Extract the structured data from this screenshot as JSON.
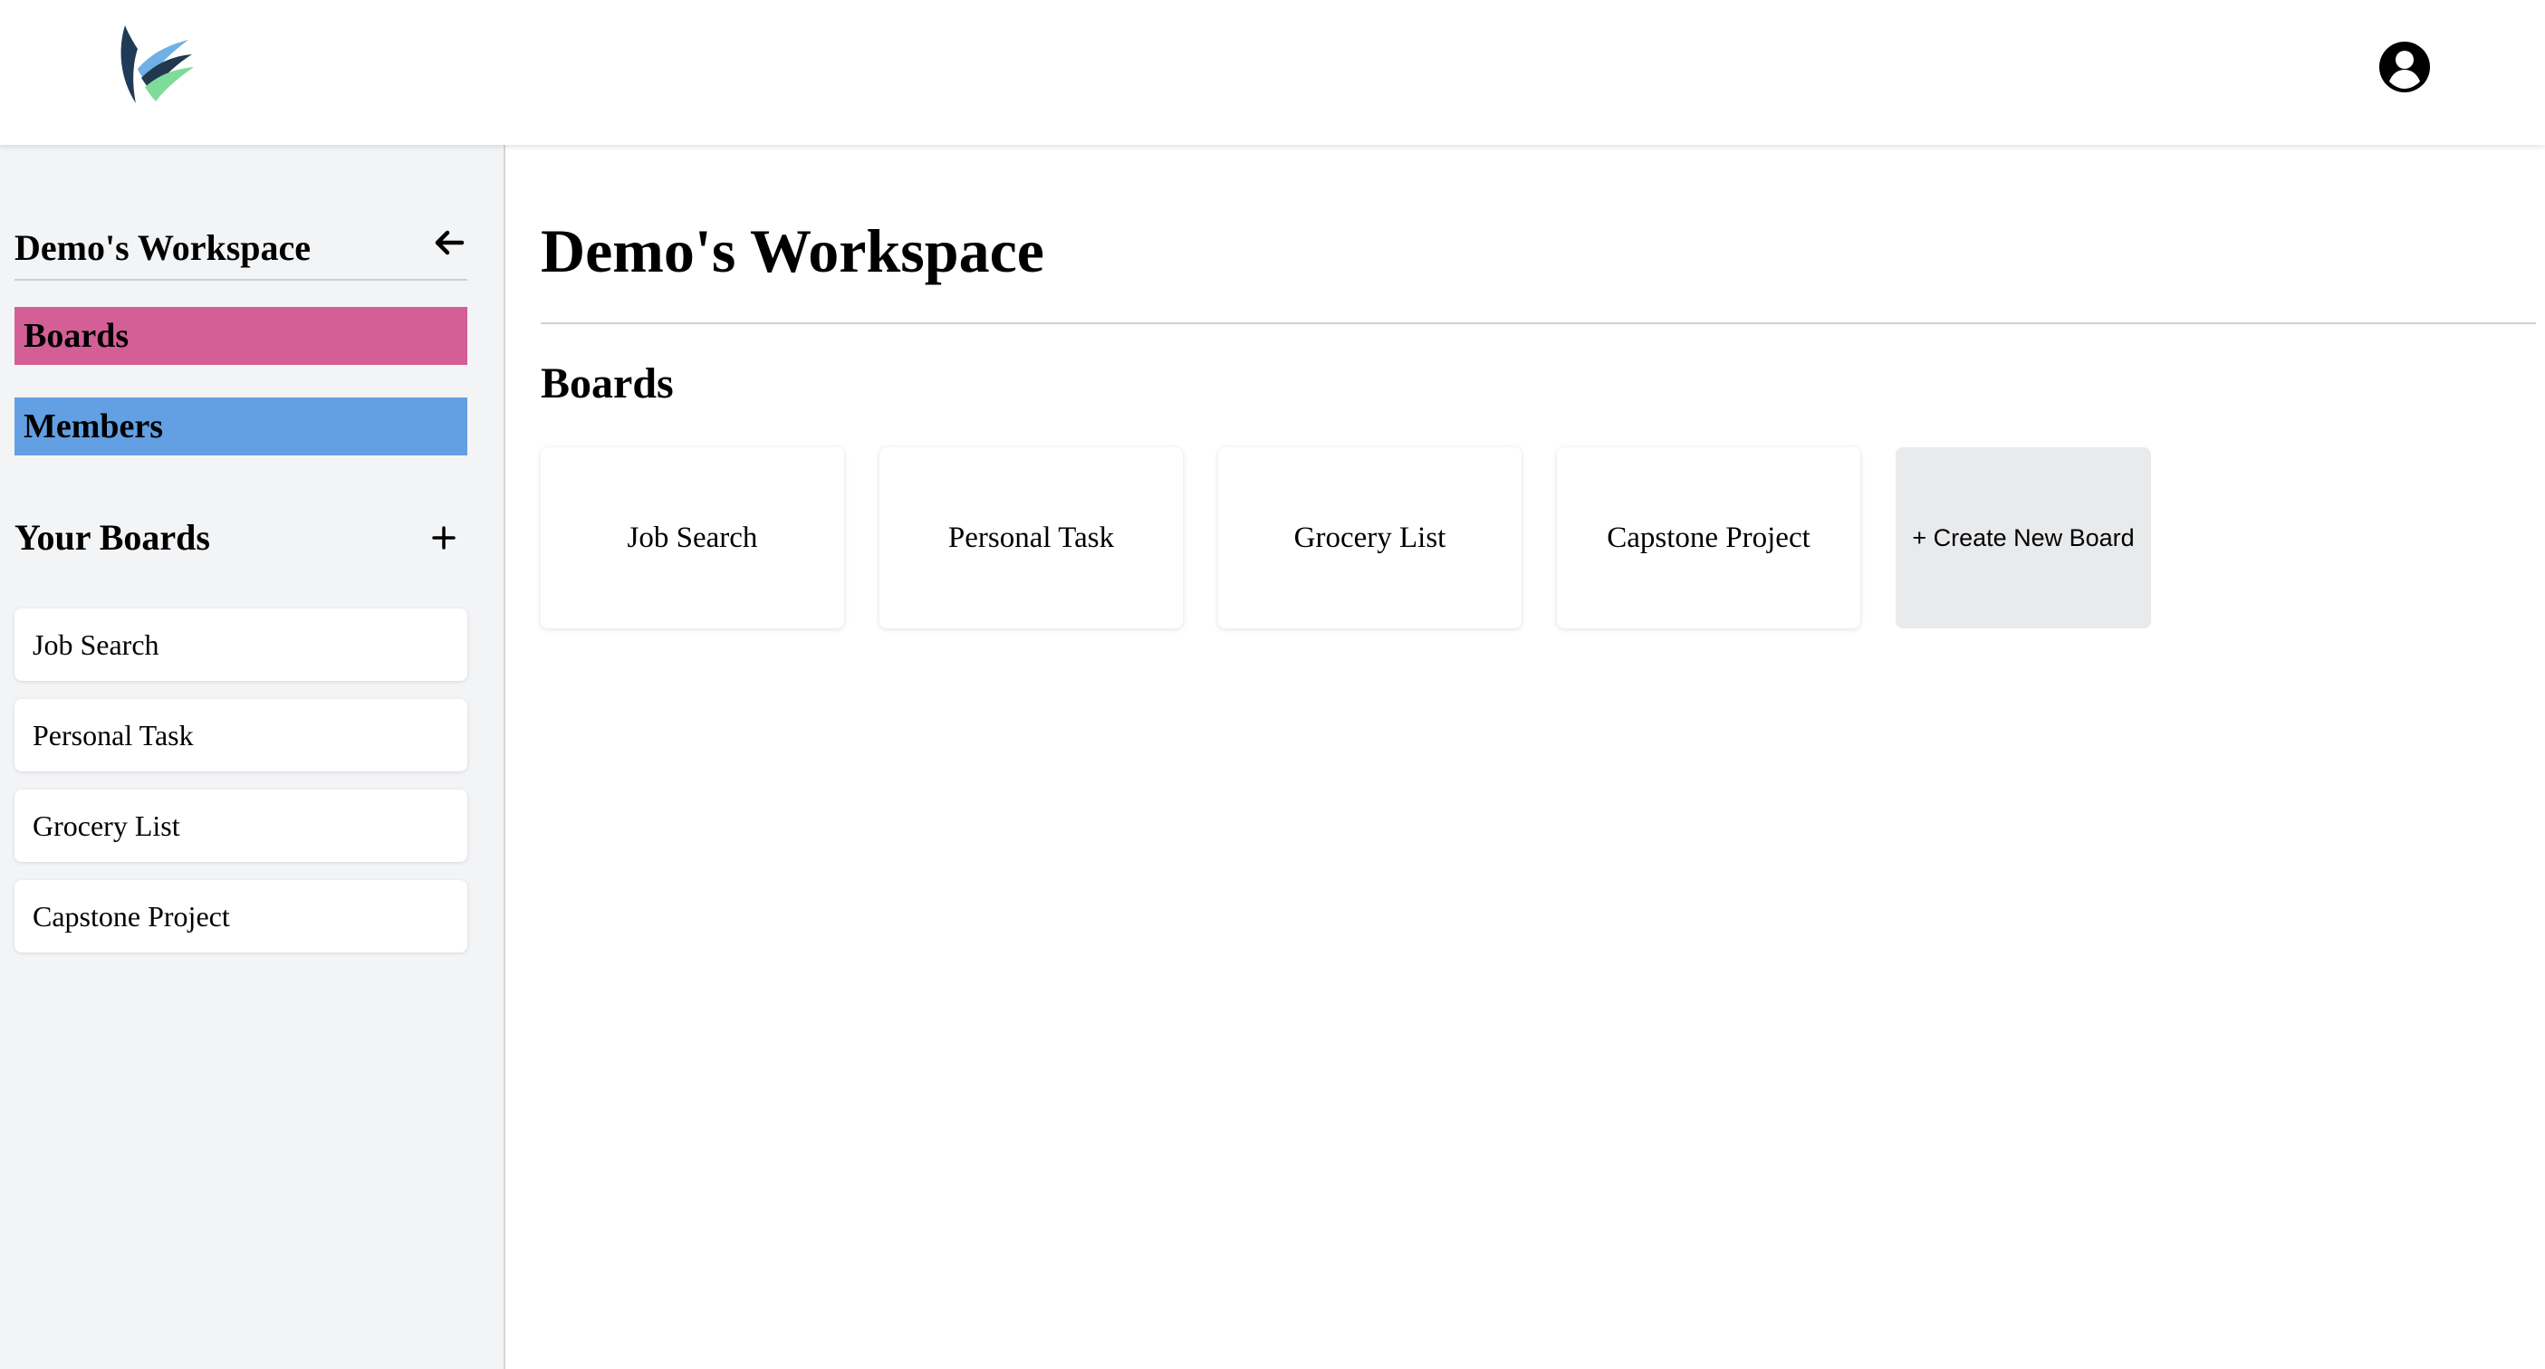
{
  "header": {
    "logo_icon": "brand-logo-icon",
    "profile_icon": "user-circle-icon"
  },
  "sidebar": {
    "workspace_title": "Demo's Workspace",
    "collapse_icon": "arrow-left-icon",
    "nav": [
      {
        "label": "Boards",
        "color": "#d35f96"
      },
      {
        "label": "Members",
        "color": "#629fe3"
      }
    ],
    "your_boards_title": "Your Boards",
    "add_icon": "plus-icon",
    "boards": [
      "Job Search",
      "Personal Task",
      "Grocery List",
      "Capstone Project"
    ]
  },
  "main": {
    "title": "Demo's Workspace",
    "boards_heading": "Boards",
    "boards": [
      "Job Search",
      "Personal Task",
      "Grocery List",
      "Capstone Project"
    ],
    "create_label": "+ Create New Board"
  }
}
